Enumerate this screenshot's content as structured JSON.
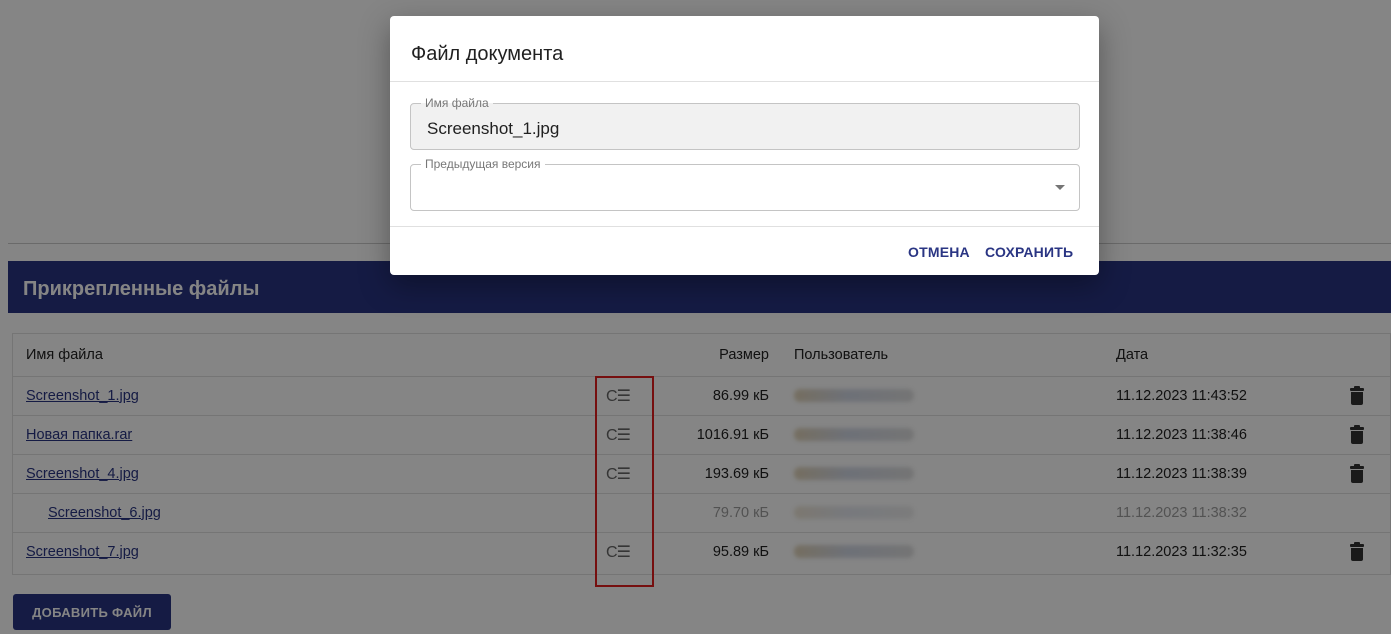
{
  "section": {
    "title": "Прикрепленные файлы"
  },
  "table": {
    "headers": {
      "name": "Имя файла",
      "size": "Размер",
      "user": "Пользователь",
      "date": "Дата"
    },
    "rows": [
      {
        "name": "Screenshot_1.jpg",
        "size": "86.99 кБ",
        "date": "11.12.2023 11:43:52"
      },
      {
        "name": "Новая папка.rar",
        "size": "1016.91 кБ",
        "date": "11.12.2023 11:38:46"
      },
      {
        "name": "Screenshot_4.jpg",
        "size": "193.69 кБ",
        "date": "11.12.2023 11:38:39"
      },
      {
        "name": "Screenshot_6.jpg",
        "size": "79.70 кБ",
        "date": "11.12.2023 11:38:32"
      },
      {
        "name": "Screenshot_7.jpg",
        "size": "95.89 кБ",
        "date": "11.12.2023 11:32:35"
      }
    ],
    "version_icon_glyph": "C☰"
  },
  "add_button_label": "ДОБАВИТЬ ФАЙЛ",
  "dialog": {
    "title": "Файл документа",
    "filename_label": "Имя файла",
    "filename_value": "Screenshot_1.jpg",
    "previous_version_label": "Предыдущая версия",
    "previous_version_value": "",
    "cancel_label": "ОТМЕНА",
    "save_label": "СОХРАНИТЬ"
  },
  "colors": {
    "brand": "#2a3583",
    "highlight": "#e21d1d"
  },
  "icons": {
    "version": "version-list-icon",
    "delete": "trash-icon",
    "select": "caret-down-icon"
  }
}
